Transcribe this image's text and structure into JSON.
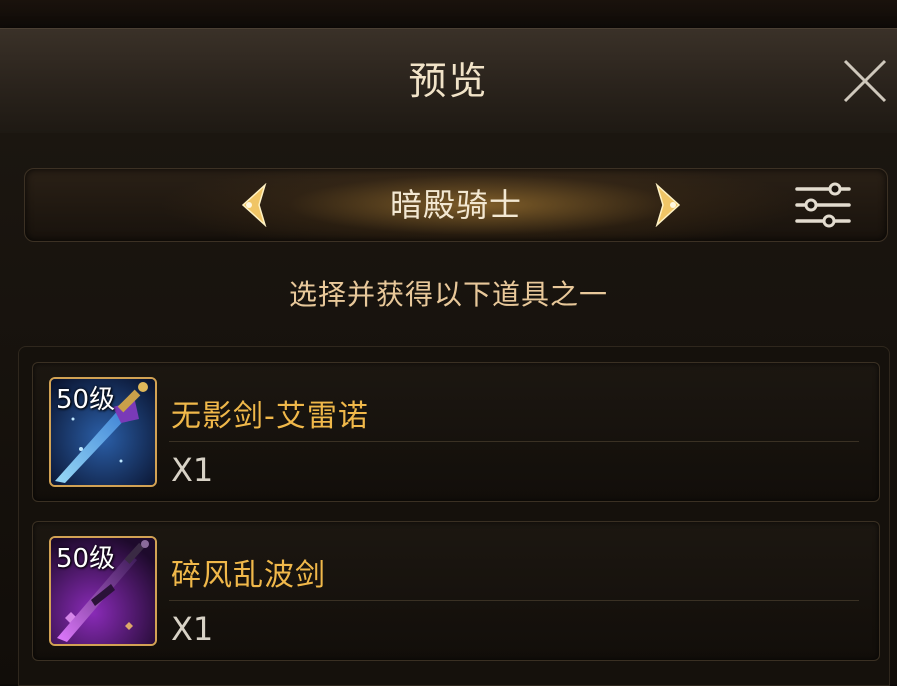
{
  "header": {
    "title": "预览"
  },
  "selector": {
    "name": "暗殿骑士"
  },
  "subtitle": "选择并获得以下道具之一",
  "items": [
    {
      "level": "50级",
      "name": "无影剑-艾雷诺",
      "quantity": "X1",
      "icon": "blue-sword-icon"
    },
    {
      "level": "50级",
      "name": "碎风乱波剑",
      "quantity": "X1",
      "icon": "purple-sword-icon"
    }
  ],
  "colors": {
    "accent": "#f0b84a",
    "frame": "#d2a254",
    "subtitle": "#e8c89a"
  }
}
